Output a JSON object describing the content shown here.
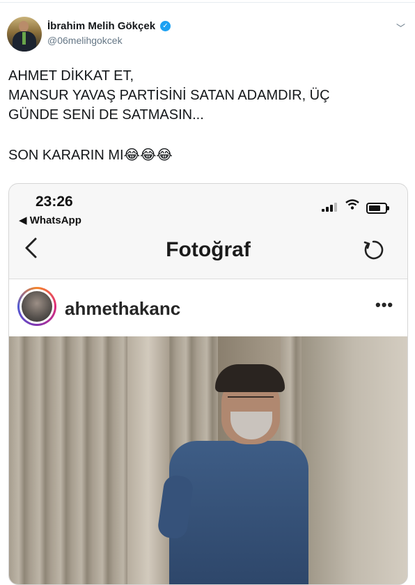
{
  "tweet": {
    "author_name": "İbrahim Melih Gökçek",
    "verified_icon": "verified-badge-icon",
    "handle": "@06melihgokcek",
    "menu_icon": "chevron-down-icon",
    "text_lines": [
      "AHMET DİKKAT ET,",
      "MANSUR YAVAŞ PARTİSİNİ SATAN ADAMDIR, ÜÇ",
      "GÜNDE SENİ DE SATMASIN...",
      "",
      "SON KARARIN MI😂😂😂"
    ]
  },
  "embedded_screenshot": {
    "status_bar": {
      "time": "23:26",
      "back_app": "◀ WhatsApp"
    },
    "nav": {
      "back_icon": "chevron-left-icon",
      "title": "Fotoğraf",
      "refresh_icon": "refresh-icon"
    },
    "post": {
      "username": "ahmethakanc",
      "more_icon": "more-horizontal-icon"
    }
  },
  "colors": {
    "verified_blue": "#1da1f2",
    "handle_gray": "#657786",
    "text": "#14171a"
  }
}
